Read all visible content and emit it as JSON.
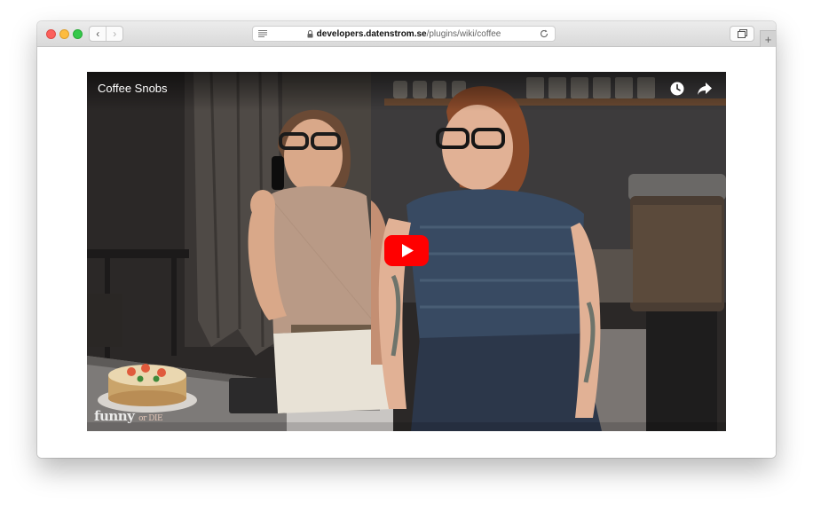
{
  "browser": {
    "url_domain": "developers.datenstrom.se",
    "url_path": "/plugins/wiki/coffee",
    "back_glyph": "‹",
    "forward_glyph": "›",
    "newtab_glyph": "+"
  },
  "video": {
    "title": "Coffee Snobs",
    "watermark_main": "funny",
    "watermark_small": "or DIE",
    "icons": [
      "watch-later-icon",
      "share-icon",
      "youtube-play-icon"
    ],
    "accent_color": "#ff0000"
  }
}
